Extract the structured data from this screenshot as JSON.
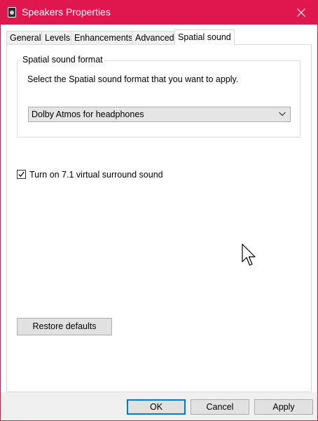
{
  "window": {
    "title": "Speakers Properties",
    "accent_color": "#e0174f"
  },
  "tabs": [
    {
      "label": "General",
      "selected": false
    },
    {
      "label": "Levels",
      "selected": false
    },
    {
      "label": "Enhancements",
      "selected": false
    },
    {
      "label": "Advanced",
      "selected": false
    },
    {
      "label": "Spatial sound",
      "selected": true
    }
  ],
  "spatial": {
    "group_title": "Spatial sound format",
    "description": "Select the Spatial sound format that you want to apply.",
    "format_selected": "Dolby Atmos for headphones",
    "surround_checkbox": {
      "label": "Turn on 7.1 virtual surround sound",
      "checked": true
    },
    "restore_label": "Restore defaults"
  },
  "footer": {
    "ok": "OK",
    "cancel": "Cancel",
    "apply": "Apply"
  },
  "icons": {
    "app": "speaker-icon",
    "close": "close-icon",
    "dropdown": "chevron-down-icon",
    "check": "checkmark-icon",
    "pointer": "mouse-pointer-icon"
  }
}
